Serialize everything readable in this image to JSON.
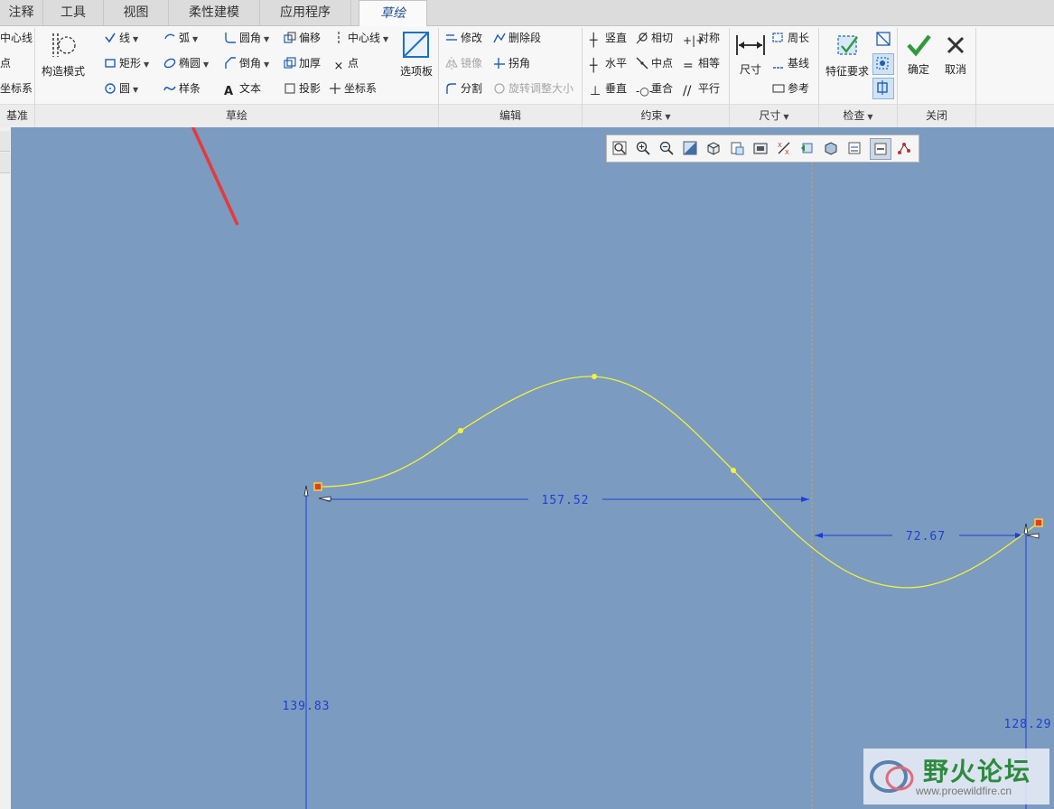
{
  "tabs": [
    {
      "label": "注释",
      "active": false
    },
    {
      "label": "工具",
      "active": false
    },
    {
      "label": "视图",
      "active": false
    },
    {
      "label": "柔性建模",
      "active": false
    },
    {
      "label": "应用程序",
      "active": false
    },
    {
      "label": "草绘",
      "active": true
    }
  ],
  "datum_group": {
    "label": "基准",
    "items": [
      "中心线",
      "点",
      "坐标系"
    ]
  },
  "sketch_group": {
    "label": "草绘",
    "construction_mode": "构造模式",
    "palette": "选项板",
    "col1": [
      "线",
      "矩形",
      "圆"
    ],
    "col2": [
      "弧",
      "椭圆",
      "样条"
    ],
    "col3": [
      "圆角",
      "倒角",
      "文本"
    ],
    "col4": [
      "偏移",
      "加厚",
      "投影"
    ],
    "col5": [
      "中心线",
      "点",
      "坐标系"
    ]
  },
  "edit_group": {
    "label": "编辑",
    "items": [
      "修改",
      "删除段",
      "镜像",
      "拐角",
      "分割",
      "旋转调整大小"
    ]
  },
  "constraint_group": {
    "label": "约束",
    "col1": [
      "竖直",
      "水平",
      "垂直"
    ],
    "col2": [
      "相切",
      "中点",
      "重合"
    ],
    "col3": [
      "对称",
      "相等",
      "平行"
    ]
  },
  "dimension_group": {
    "label": "尺寸",
    "dimension": "尺寸",
    "items": [
      "周长",
      "基线",
      "参考"
    ]
  },
  "inspect_group": {
    "label": "检查",
    "feature_requirements": "特征要求"
  },
  "close_group": {
    "label": "关闭",
    "ok": "确定",
    "cancel": "取消"
  },
  "dimensions": {
    "horizontal_long": "157.52",
    "horizontal_short": "72.67",
    "vertical_left": "139.83",
    "vertical_right": "128.29"
  },
  "colors": {
    "canvas": "#7b9bc0",
    "spline": "#f2f23a",
    "dimension": "#1e3fd8",
    "annotation_arrow": "#e8383a",
    "ok_check": "#2e9a3a"
  },
  "watermark": {
    "title": "野火论坛",
    "url": "www.proewildfire.cn"
  }
}
